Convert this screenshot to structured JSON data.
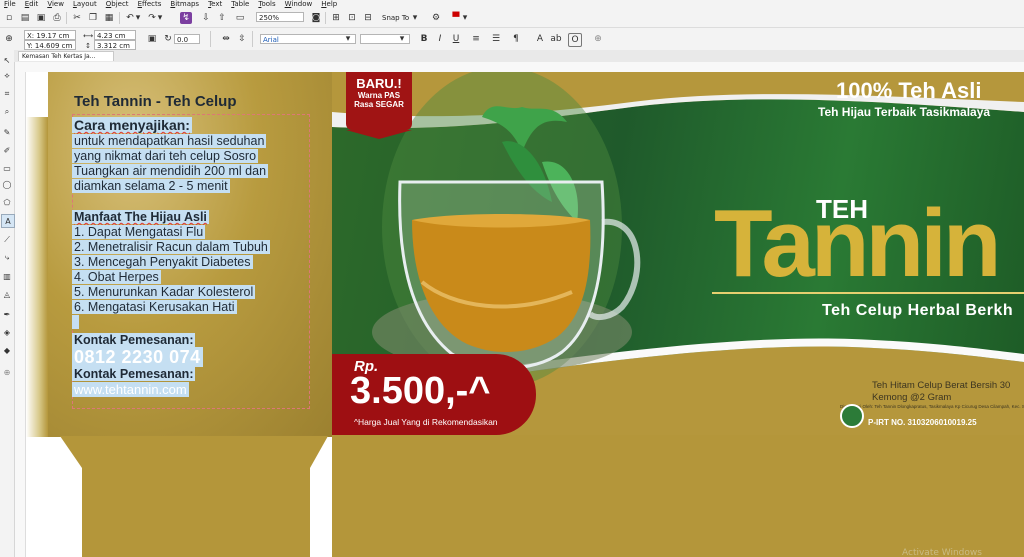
{
  "menu": [
    "File",
    "Edit",
    "View",
    "Layout",
    "Object",
    "Effects",
    "Bitmaps",
    "Text",
    "Table",
    "Tools",
    "Window",
    "Help"
  ],
  "toolbar": {
    "zoom": "250%",
    "snap_to": "Snap To",
    "x_value": "X: 19.17 cm",
    "y_value": "Y: 14.609 cm",
    "w_value": "4.23 cm",
    "h_value": "3.312 cm",
    "angle": "0.0",
    "font_name": "Arial",
    "font_size": "",
    "colors": {
      "accent": "#7b3fa0",
      "toolbar_bg": "#f3f3f3"
    }
  },
  "document_tab": "Kemasan Teh Kertas Ja...",
  "panel": {
    "title": "Teh Tannin - Teh Celup",
    "serving_heading": "Cara menyajikan:",
    "serving_lines": [
      "untuk mendapatkan hasil seduhan",
      "yang nikmat dari teh celup Sosro",
      "Tuangkan air mendidih 200 ml dan",
      "diamkan selama 2 - 5 menit"
    ],
    "benefits_heading": "Manfaat The Hijau Asli",
    "benefits": [
      "1. Dapat Mengatasi Flu",
      "2. Menetralisir Racun dalam Tubuh",
      "3. Mencegah Penyakit Diabetes",
      "4. Obat Herpes",
      "5. Menurunkan Kadar Kolesterol",
      "6. Mengatasi Kerusakan Hati"
    ],
    "contact_heading": "Kontak Pemesanan:",
    "phone": "0812  2230  074",
    "contact_heading2": "Kontak Pemesanan:",
    "website": "www.tehtannin.com"
  },
  "front": {
    "badge_new": "BARU.!",
    "badge_line1": "Warna PAS",
    "badge_line2": "Rasa SEGAR",
    "headline": "100% Teh Asli",
    "subheadline": "Teh Hijau Terbaik Tasikmalaya",
    "brand_small": "TEH",
    "brand_big": "Tannin",
    "tagline": "Teh Celup Herbal Berkh",
    "price_rp": "Rp.",
    "price": "3.500,-^",
    "price_note": "^Harga Jual Yang di Rekomendasikan",
    "info_line1": "Teh Hitam Celup Berat Bersih 30",
    "info_line2": "Kemong @2 Gram",
    "info_small": "Diproduksi Oleh: Teh Tannin Dlongkapratus, Tasikmalaya Kp Cicurug Desa Cilampah, Kec. Sukaresik, Tasikmalaya Jawa Barat 46183",
    "pirt": "P-IRT NO. 3103206010019.25",
    "watermark": "Activate Windows"
  }
}
